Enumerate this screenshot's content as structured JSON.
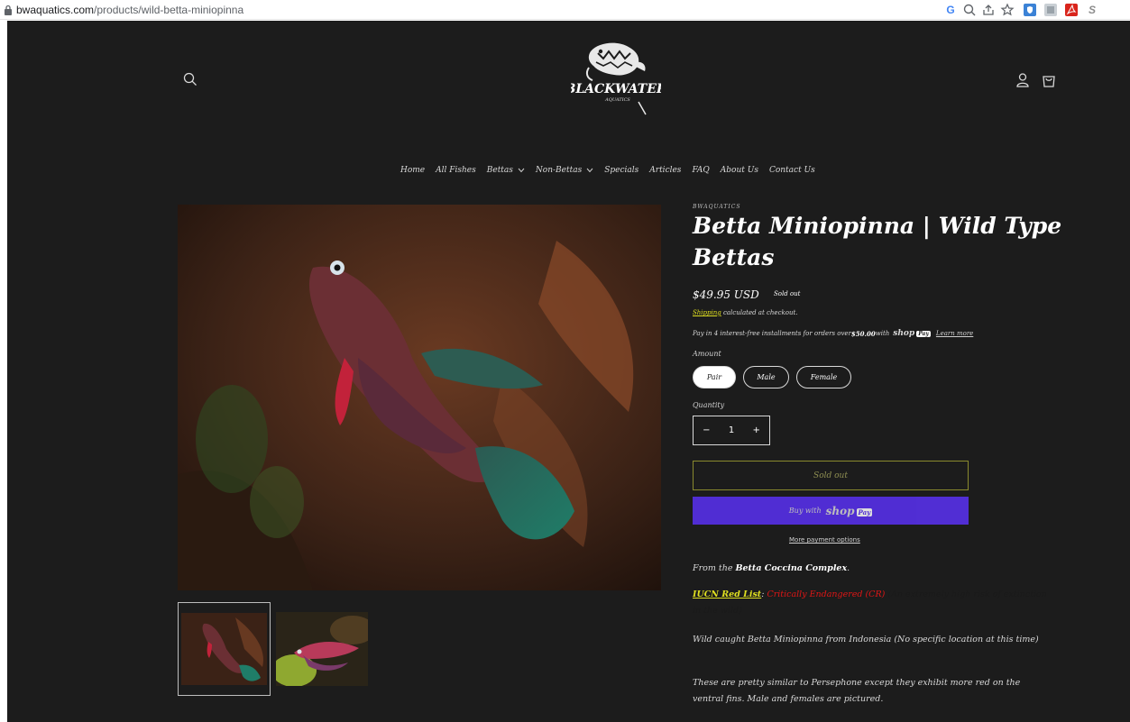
{
  "browser": {
    "url_host": "bwaquatics.com",
    "url_path": "/products/wild-betta-miniopinna",
    "extensions": [
      "G",
      "S"
    ]
  },
  "header": {
    "logo_text": "BLACKWATER",
    "logo_subtext": "AQUATICS"
  },
  "nav": {
    "items": [
      {
        "label": "Home"
      },
      {
        "label": "All Fishes"
      },
      {
        "label": "Bettas",
        "has_dropdown": true
      },
      {
        "label": "Non-Bettas",
        "has_dropdown": true
      },
      {
        "label": "Specials"
      },
      {
        "label": "Articles"
      },
      {
        "label": "FAQ"
      },
      {
        "label": "About Us"
      },
      {
        "label": "Contact Us"
      }
    ]
  },
  "product": {
    "vendor": "BWAQUATICS",
    "title": "Betta Miniopinna | Wild Type Bettas",
    "price": "$49.95 USD",
    "badge": "Sold out",
    "shipping_link": "Shipping",
    "shipping_text": " calculated at checkout.",
    "paylater_text": "Pay in 4 interest-free installments for orders over ",
    "paylater_threshold": "$50.00",
    "paylater_with": " with",
    "shoppay_word": "shop",
    "shoppay_badge": "Pay",
    "learn_more": "Learn more",
    "amount_label": "Amount",
    "amount_options": [
      "Pair",
      "Male",
      "Female"
    ],
    "amount_selected": "Pair",
    "quantity_label": "Quantity",
    "quantity_value": "1",
    "minus": "−",
    "plus": "+",
    "soldout_button": "Sold out",
    "buy_with": "Buy with",
    "more_payment": "More payment options"
  },
  "description": {
    "p1_prefix": "From the ",
    "p1_bold": "Betta Coccina Complex",
    "p1_suffix": ".",
    "iucn_label": "IUCN Red List",
    "iucn_colon": ": ",
    "iucn_status": "Critically Endangered (CR)",
    "iucn_note": " (An extremely high risk of extinction in the wild)",
    "p3": "Wild caught Betta Miniopinna from Indonesia (No specific location at this time)",
    "p4": "These are pretty similar to Persephone except they exhibit more red on the ventral fins. Male and females are pictured."
  },
  "colors": {
    "background": "#1c1c1c",
    "accent_yellow": "#e0e020",
    "critical_red": "#e01515",
    "shoppay_purple": "#5a31f4"
  }
}
